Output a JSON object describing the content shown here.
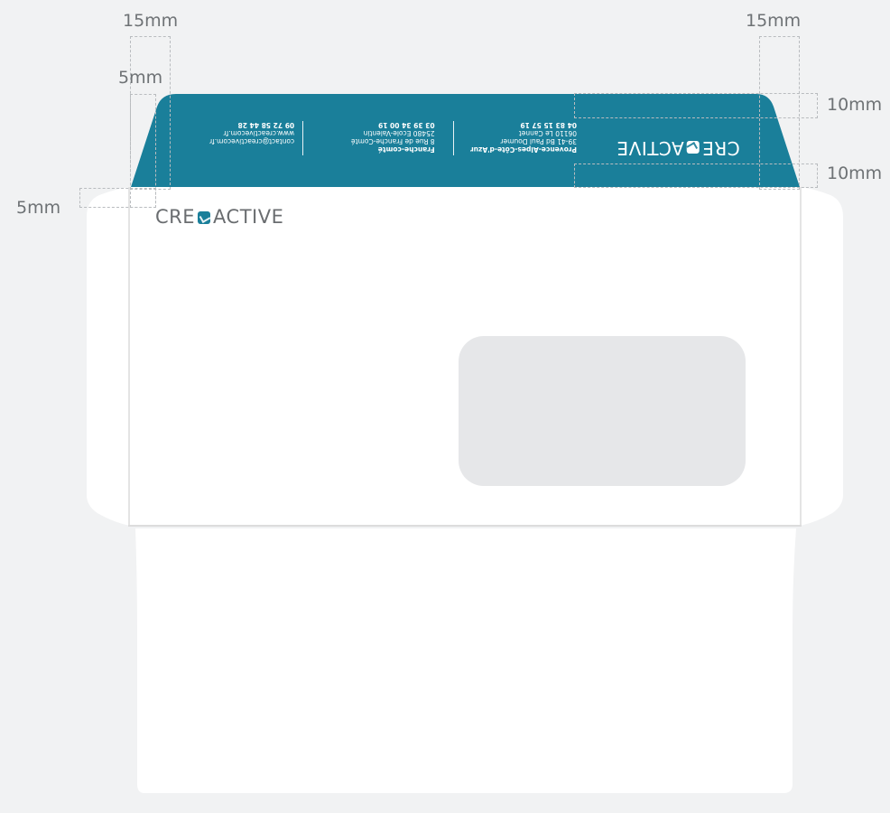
{
  "colors": {
    "background": "#f1f2f3",
    "paper": "#ffffff",
    "flap": "#1a7f9a",
    "window": "#e6e7e9",
    "guide": "#b9bcbf",
    "fold_line": "#dcdcdc"
  },
  "dimensions": {
    "top_left": "15mm",
    "left_small": "5mm",
    "left_margin": "5mm",
    "top_right": "15mm",
    "right_upper": "10mm",
    "right_lower": "10mm"
  },
  "logo": {
    "left": "CRE",
    "right": "ACTIVE"
  },
  "flap": {
    "office1": {
      "title": "Provence-Alpes-Côte-d'Azur",
      "street": "39-41 Bd Paul Doumer",
      "city": "06110 Le Cannet",
      "phone": "04 83 15 57 19"
    },
    "office2": {
      "title": "Franche-comté",
      "street": "8 Rue de Franche-Comté",
      "city": "25480 Ecole-Valentin",
      "phone": "03 39 34 00 19"
    },
    "contact": {
      "email": "contact@creactivecom.fr",
      "web": "www.creactivecom.fr",
      "phone": "09 72 58 44 28"
    }
  }
}
